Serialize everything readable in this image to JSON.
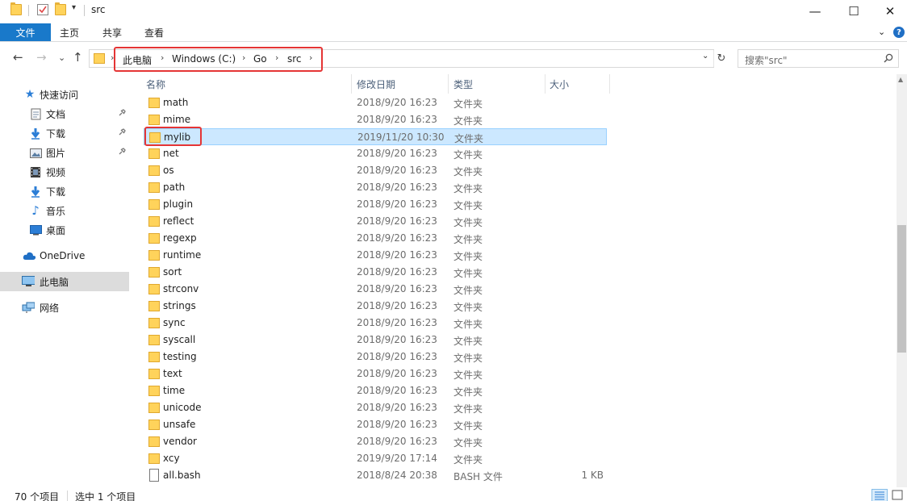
{
  "window": {
    "title": "src",
    "minimize": "—",
    "maximize": "☐",
    "close": "✕"
  },
  "ribbon": {
    "file_tab": "文件",
    "tabs": [
      "主页",
      "共享",
      "查看"
    ],
    "collapse": "⌄",
    "help": "?"
  },
  "nav": {
    "back": "←",
    "forward": "→",
    "recent": "⌄",
    "up": "↑",
    "chevron": "›",
    "breadcrumb": [
      "此电脑",
      "Windows (C:)",
      "Go",
      "src"
    ],
    "refresh": "↻",
    "dropdown": "⌄",
    "search_placeholder": "搜索\"src\"",
    "search_icon": "⚲"
  },
  "sidebar": {
    "quick_access": "快速访问",
    "items": [
      {
        "label": "文档",
        "icon": "document-icon",
        "pinned": true
      },
      {
        "label": "下载",
        "icon": "download-icon",
        "pinned": true
      },
      {
        "label": "图片",
        "icon": "picture-icon",
        "pinned": true
      },
      {
        "label": "视频",
        "icon": "video-icon",
        "pinned": false
      },
      {
        "label": "下载",
        "icon": "download-icon",
        "pinned": false
      },
      {
        "label": "音乐",
        "icon": "music-icon",
        "pinned": false
      },
      {
        "label": "桌面",
        "icon": "desktop-icon",
        "pinned": false
      }
    ],
    "onedrive": "OneDrive",
    "this_pc": "此电脑",
    "network": "网络",
    "pin_glyph": "📌"
  },
  "columns": {
    "name": "名称",
    "date": "修改日期",
    "type": "类型",
    "size": "大小",
    "sort_caret": "^"
  },
  "files": [
    {
      "name": "math",
      "date": "2018/9/20 16:23",
      "type": "文件夹",
      "size": "",
      "kind": "folder"
    },
    {
      "name": "mime",
      "date": "2018/9/20 16:23",
      "type": "文件夹",
      "size": "",
      "kind": "folder"
    },
    {
      "name": "mylib",
      "date": "2019/11/20 10:30",
      "type": "文件夹",
      "size": "",
      "kind": "folder",
      "selected": true
    },
    {
      "name": "net",
      "date": "2018/9/20 16:23",
      "type": "文件夹",
      "size": "",
      "kind": "folder"
    },
    {
      "name": "os",
      "date": "2018/9/20 16:23",
      "type": "文件夹",
      "size": "",
      "kind": "folder"
    },
    {
      "name": "path",
      "date": "2018/9/20 16:23",
      "type": "文件夹",
      "size": "",
      "kind": "folder"
    },
    {
      "name": "plugin",
      "date": "2018/9/20 16:23",
      "type": "文件夹",
      "size": "",
      "kind": "folder"
    },
    {
      "name": "reflect",
      "date": "2018/9/20 16:23",
      "type": "文件夹",
      "size": "",
      "kind": "folder"
    },
    {
      "name": "regexp",
      "date": "2018/9/20 16:23",
      "type": "文件夹",
      "size": "",
      "kind": "folder"
    },
    {
      "name": "runtime",
      "date": "2018/9/20 16:23",
      "type": "文件夹",
      "size": "",
      "kind": "folder"
    },
    {
      "name": "sort",
      "date": "2018/9/20 16:23",
      "type": "文件夹",
      "size": "",
      "kind": "folder"
    },
    {
      "name": "strconv",
      "date": "2018/9/20 16:23",
      "type": "文件夹",
      "size": "",
      "kind": "folder"
    },
    {
      "name": "strings",
      "date": "2018/9/20 16:23",
      "type": "文件夹",
      "size": "",
      "kind": "folder"
    },
    {
      "name": "sync",
      "date": "2018/9/20 16:23",
      "type": "文件夹",
      "size": "",
      "kind": "folder"
    },
    {
      "name": "syscall",
      "date": "2018/9/20 16:23",
      "type": "文件夹",
      "size": "",
      "kind": "folder"
    },
    {
      "name": "testing",
      "date": "2018/9/20 16:23",
      "type": "文件夹",
      "size": "",
      "kind": "folder"
    },
    {
      "name": "text",
      "date": "2018/9/20 16:23",
      "type": "文件夹",
      "size": "",
      "kind": "folder"
    },
    {
      "name": "time",
      "date": "2018/9/20 16:23",
      "type": "文件夹",
      "size": "",
      "kind": "folder"
    },
    {
      "name": "unicode",
      "date": "2018/9/20 16:23",
      "type": "文件夹",
      "size": "",
      "kind": "folder"
    },
    {
      "name": "unsafe",
      "date": "2018/9/20 16:23",
      "type": "文件夹",
      "size": "",
      "kind": "folder"
    },
    {
      "name": "vendor",
      "date": "2018/9/20 16:23",
      "type": "文件夹",
      "size": "",
      "kind": "folder"
    },
    {
      "name": "xcy",
      "date": "2019/9/20 17:14",
      "type": "文件夹",
      "size": "",
      "kind": "folder"
    },
    {
      "name": "all.bash",
      "date": "2018/8/24 20:38",
      "type": "BASH 文件",
      "size": "1 KB",
      "kind": "file"
    }
  ],
  "status": {
    "item_count": "70 个项目",
    "selected": "选中 1 个项目"
  },
  "scrollbar": {
    "up": "▲"
  },
  "colors": {
    "accent": "#1979ca",
    "selection": "#cce8ff",
    "highlight_box": "#e53535"
  }
}
